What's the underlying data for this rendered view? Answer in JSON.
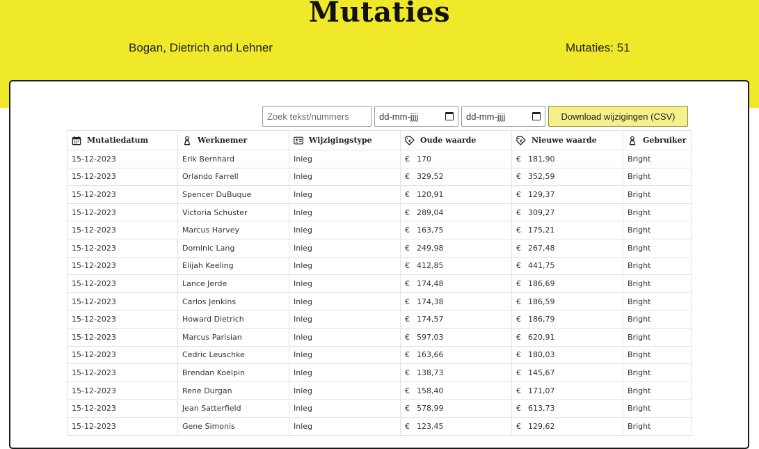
{
  "header": {
    "title": "Mutaties",
    "company": "Bogan, Dietrich and Lehner",
    "count_label": "Mutaties: 51"
  },
  "toolbar": {
    "search_placeholder": "Zoek tekst/nummers",
    "date_from": "dd-mm-jjjj",
    "date_to": "dd-mm-jjjj",
    "download_label": "Download wijzigingen (CSV)"
  },
  "table": {
    "columns": [
      {
        "label": "Mutatiedatum",
        "icon": "calendar-icon"
      },
      {
        "label": "Werknemer",
        "icon": "person-icon"
      },
      {
        "label": "Wijzigingstype",
        "icon": "id-card-icon"
      },
      {
        "label": "Oude waarde",
        "icon": "money-tag-icon"
      },
      {
        "label": "Nieuwe waarde",
        "icon": "money-tag-icon"
      },
      {
        "label": "Gebruiker",
        "icon": "person-icon"
      }
    ],
    "currency": "€",
    "rows": [
      [
        "15-12-2023",
        "Erik Bernhard",
        "Inleg",
        "170",
        "181,90",
        "Bright"
      ],
      [
        "15-12-2023",
        "Orlando Farrell",
        "Inleg",
        "329,52",
        "352,59",
        "Bright"
      ],
      [
        "15-12-2023",
        "Spencer DuBuque",
        "Inleg",
        "120,91",
        "129,37",
        "Bright"
      ],
      [
        "15-12-2023",
        "Victoria Schuster",
        "Inleg",
        "289,04",
        "309,27",
        "Bright"
      ],
      [
        "15-12-2023",
        "Marcus Harvey",
        "Inleg",
        "163,75",
        "175,21",
        "Bright"
      ],
      [
        "15-12-2023",
        "Dominic Lang",
        "Inleg",
        "249,98",
        "267,48",
        "Bright"
      ],
      [
        "15-12-2023",
        "Elijah Keeling",
        "Inleg",
        "412,85",
        "441,75",
        "Bright"
      ],
      [
        "15-12-2023",
        "Lance Jerde",
        "Inleg",
        "174,48",
        "186,69",
        "Bright"
      ],
      [
        "15-12-2023",
        "Carlos Jenkins",
        "Inleg",
        "174,38",
        "186,59",
        "Bright"
      ],
      [
        "15-12-2023",
        "Howard Dietrich",
        "Inleg",
        "174,57",
        "186,79",
        "Bright"
      ],
      [
        "15-12-2023",
        "Marcus Parisian",
        "Inleg",
        "597,03",
        "620,91",
        "Bright"
      ],
      [
        "15-12-2023",
        "Cedric Leuschke",
        "Inleg",
        "163,66",
        "180,03",
        "Bright"
      ],
      [
        "15-12-2023",
        "Brendan Koelpin",
        "Inleg",
        "138,73",
        "145,67",
        "Bright"
      ],
      [
        "15-12-2023",
        "Rene Durgan",
        "Inleg",
        "158,40",
        "171,07",
        "Bright"
      ],
      [
        "15-12-2023",
        "Jean Satterfield",
        "Inleg",
        "578,99",
        "613,73",
        "Bright"
      ],
      [
        "15-12-2023",
        "Gene Simonis",
        "Inleg",
        "123,45",
        "129,62",
        "Bright"
      ]
    ]
  },
  "colors": {
    "header_bg": "#f0e92a",
    "button_bg": "#f5f08a"
  }
}
